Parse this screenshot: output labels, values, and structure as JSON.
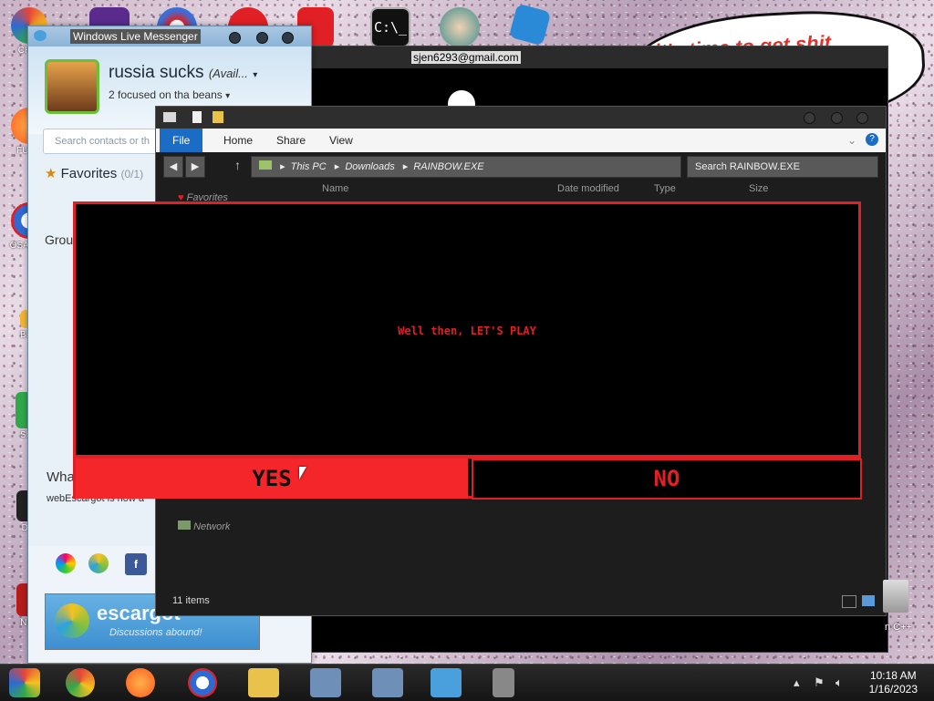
{
  "desktop": {
    "icons": [
      {
        "label": "CH D",
        "color": "#e6453a"
      },
      {
        "label": "FURR",
        "color": "#ff7c1f"
      },
      {
        "label": "OSA LAD",
        "color": "#2f6ad2"
      },
      {
        "label": "BEE",
        "color": "#f2b632"
      },
      {
        "label": "SEX",
        "color": "#30a84a"
      },
      {
        "label": "Do",
        "color": "#222222"
      },
      {
        "label": "Not",
        "color": "#b51c1c"
      }
    ],
    "speech_bubble_text": "it's time to get shit",
    "recycle_label": "n C++"
  },
  "messenger": {
    "title": "Windows Live Messenger",
    "username": "russia sucks",
    "status": "(Avail...",
    "personal_message": "2 focused on tha beans",
    "search_placeholder": "Search contacts or th",
    "favorites_label": "Favorites",
    "favorites_count": "(0/1)",
    "groups_label": "Grou",
    "whats_new": "Wha",
    "news_text": "webEscargot is now a",
    "escargot_name": "escargot",
    "escargot_tagline": "Discussions abound!"
  },
  "console": {
    "email": "sjen6293@gmail.com"
  },
  "explorer": {
    "ribbon_tabs": [
      "File",
      "Home",
      "Share",
      "View"
    ],
    "address_parts": [
      "This PC",
      "Downloads",
      "RAINBOW.EXE"
    ],
    "search_placeholder": "Search RAINBOW.EXE",
    "columns": [
      "Name",
      "Date modified",
      "Type",
      "Size"
    ],
    "nav_favorites": "Favorites",
    "nav_network": "Network",
    "status": "11 items"
  },
  "game": {
    "message": "Well then, LET'S PLAY",
    "yes_label": "YES",
    "no_label": "NO",
    "accent_color": "#e02024"
  },
  "taskbar": {
    "time": "10:18 AM",
    "date": "1/16/2023",
    "apps": [
      "chrome-like",
      "chrome",
      "firefox",
      "obama",
      "file-explorer",
      "app-1",
      "app-2",
      "messenger",
      "pin-tool"
    ]
  }
}
